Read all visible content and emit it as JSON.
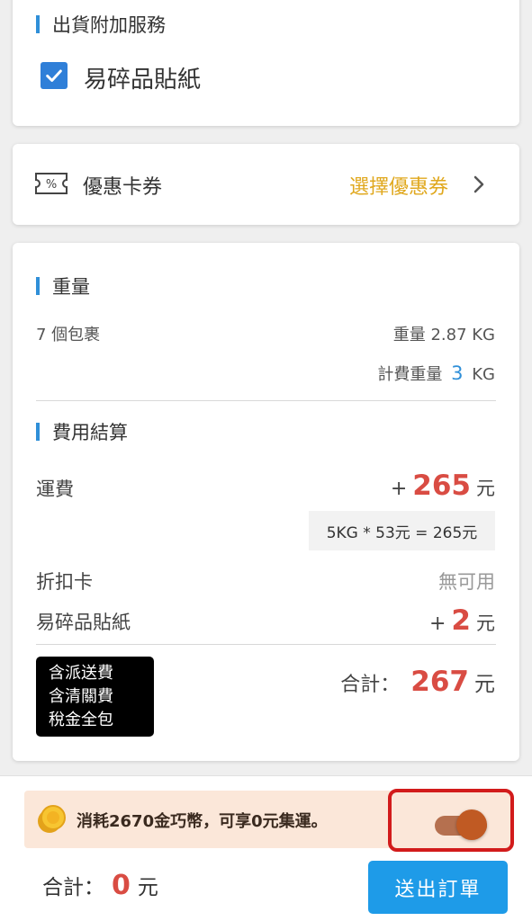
{
  "shipping_addon": {
    "title": "出貨附加服務",
    "option_label": "易碎品貼紙",
    "checked": true
  },
  "coupon": {
    "label": "優惠卡券",
    "select_label": "選擇優惠券"
  },
  "weight": {
    "title": "重量",
    "packages": "7 個包裹",
    "weight_label": "重量 2.87 KG",
    "billing_label": "計費重量",
    "billing_value": "3",
    "billing_unit": "KG"
  },
  "fees": {
    "title": "費用結算",
    "shipping_label": "運費",
    "shipping_plus": "+",
    "shipping_value": "265",
    "shipping_unit": "元",
    "formula": "5KG * 53元 = 265元",
    "discount_label": "折扣卡",
    "discount_value": "無可用",
    "sticker_label": "易碎品貼紙",
    "sticker_plus": "+",
    "sticker_value": "2",
    "sticker_unit": "元",
    "badge_lines": [
      "含派送費",
      "含清關費",
      "稅金全包"
    ],
    "total_label": "合計：",
    "total_value": "267",
    "total_unit": "元"
  },
  "promo": {
    "text": "消耗2670金巧幣，可享0元集運。",
    "toggle_on": true
  },
  "footer": {
    "total_label": "合計：",
    "total_value": "0",
    "total_unit": "元",
    "submit_label": "送出訂單"
  },
  "colors": {
    "accent": "#2f8fd8",
    "price": "#d94c43",
    "coupon": "#e0a81e",
    "submit": "#1e9be8",
    "highlight": "#d21b1b"
  }
}
